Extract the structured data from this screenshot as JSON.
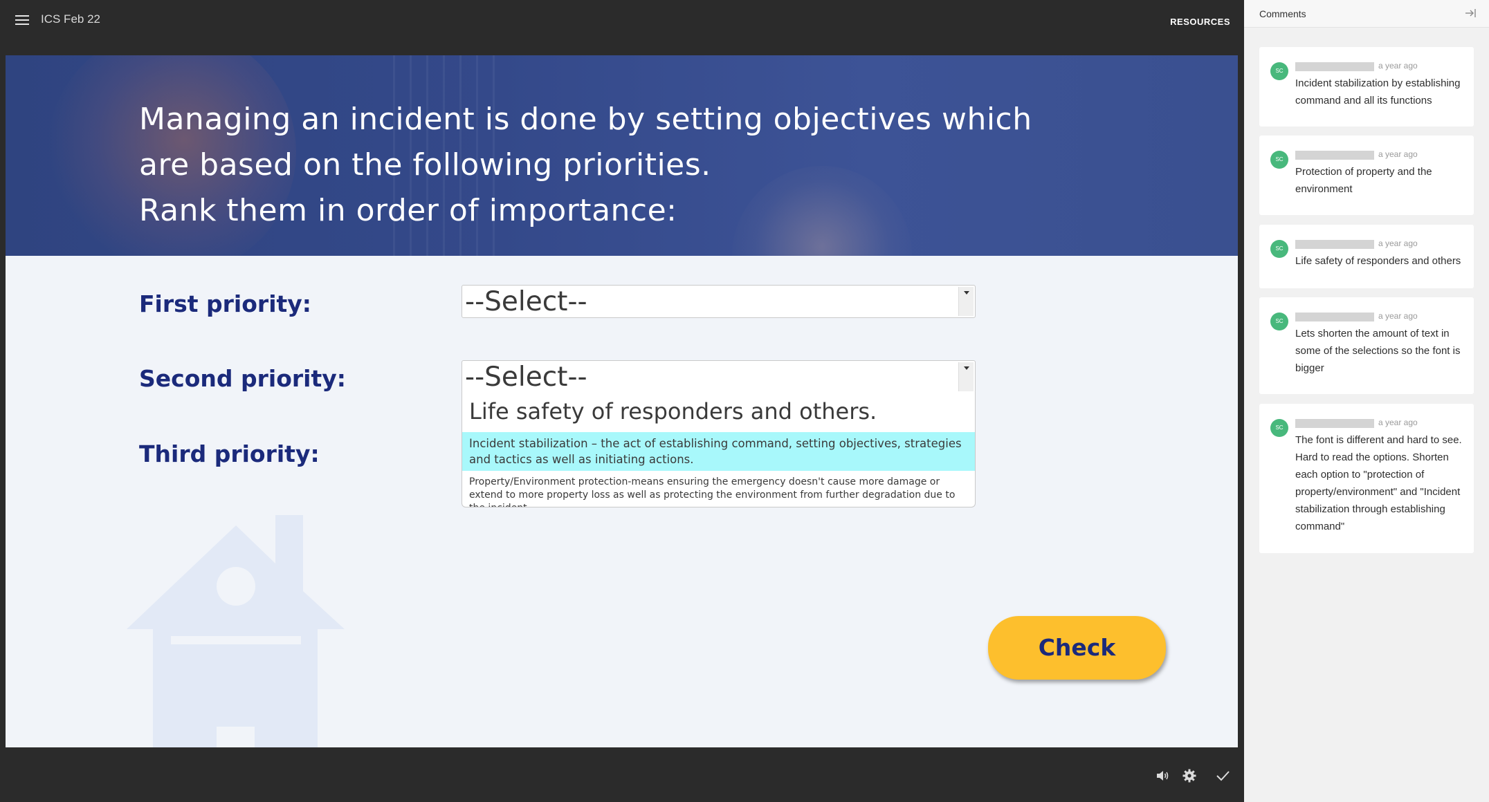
{
  "app": {
    "course_title": "ICS Feb 22",
    "resources_label": "RESOURCES"
  },
  "slide": {
    "question_lines": [
      "Managing an incident is done by setting objectives which",
      "are based on the following priorities.",
      "Rank them in order of importance:"
    ],
    "labels": [
      "First priority:",
      "Second priority:",
      "Third priority:"
    ],
    "select_placeholder": "--Select--",
    "select_first_value": "--Select--",
    "select_second_value": "--Select--",
    "dropdown_options": [
      "Life safety of responders and others.",
      "Incident stabilization – the act of establishing command, setting objectives, strategies and tactics as well as initiating actions.",
      "Property/Environment protection-means ensuring the emergency doesn't cause more damage or extend to more property loss as well as protecting the environment from further degradation due to the incident."
    ],
    "highlighted_option_index": 1,
    "check_label": "Check"
  },
  "bottom_bar": {
    "icons": [
      "audio-icon",
      "gear-icon",
      "checkmark-icon"
    ]
  },
  "comments_panel": {
    "title": "Comments",
    "comments": [
      {
        "avatar": "SC",
        "time": "a year ago",
        "text": "Incident stabilization by establishing command and all its functions"
      },
      {
        "avatar": "SC",
        "time": "a year ago",
        "text": "Protection of property and the environment"
      },
      {
        "avatar": "SC",
        "time": "a year ago",
        "text": "Life safety of responders and others"
      },
      {
        "avatar": "SC",
        "time": "a year ago",
        "text": "Lets shorten the amount of text in some of the selections so the font is bigger"
      },
      {
        "avatar": "SC",
        "time": "a year ago",
        "text": "The font is different and hard to see. Hard to read the options. Shorten each option to \"protection of property/environment\" and  \"Incident stabilization through establishing command\""
      }
    ]
  },
  "colors": {
    "banner": "#34498a",
    "label_text": "#1b2a7b",
    "check_button": "#fdbf2d",
    "option_highlight": "#a8f8fb",
    "avatar": "#48b87c",
    "chrome": "#2b2b2b"
  }
}
